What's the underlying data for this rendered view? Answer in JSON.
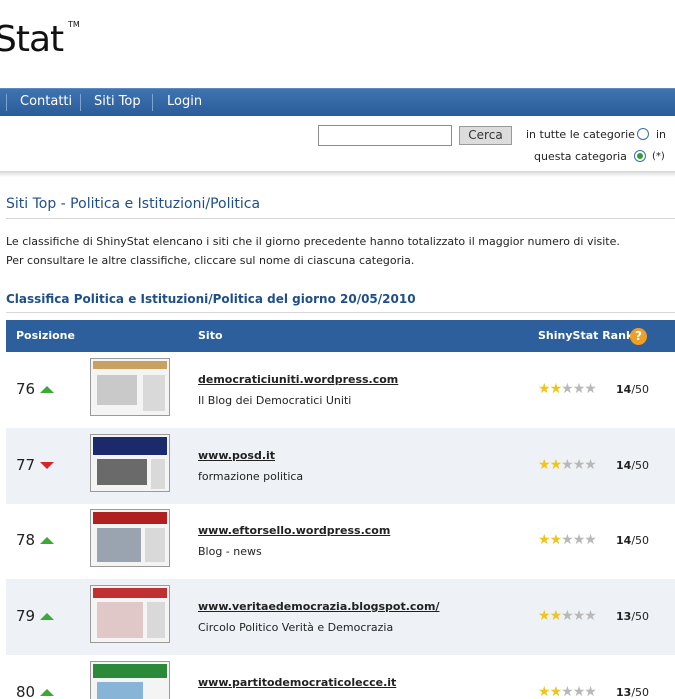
{
  "logo": {
    "text": "Stat",
    "tm": "TM"
  },
  "nav": {
    "items": [
      "Contatti",
      "Siti Top",
      "Login"
    ]
  },
  "search": {
    "value": "",
    "button": "Cerca",
    "option_all": "in tutte le categorie",
    "option_in": "in",
    "option_this": "questa categoria",
    "option_note": "(*)",
    "selected": "questa categoria"
  },
  "page": {
    "title": "Siti Top - Politica e Istituzioni/Politica",
    "intro1": "Le classifiche di ShinyStat elencano i siti che il giorno precedente hanno totalizzato il maggior numero di visite.",
    "intro2": "Per consultare le altre classifiche, cliccare sul nome di ciascuna categoria.",
    "subtitle": "Classifica Politica e Istituzioni/Politica del giorno 20/05/2010"
  },
  "table": {
    "headers": {
      "position": "Posizione",
      "site": "Sito",
      "rank": "ShinyStat Rank",
      "help": "?"
    },
    "rows": [
      {
        "position": "76",
        "trend": "up",
        "url": "democraticiuniti.wordpress.com",
        "desc": "Il Blog dei Democratici Uniti",
        "stars": 1.5,
        "score": "14",
        "max": "/50",
        "thumb_color": "#c8a060"
      },
      {
        "position": "77",
        "trend": "down",
        "url": "www.posd.it",
        "desc": "formazione politica",
        "stars": 1.5,
        "score": "14",
        "max": "/50",
        "thumb_color": "#1a2a6a"
      },
      {
        "position": "78",
        "trend": "up",
        "url": "www.eftorsello.wordpress.com",
        "desc": "Blog - news",
        "stars": 1.5,
        "score": "14",
        "max": "/50",
        "thumb_color": "#b02020"
      },
      {
        "position": "79",
        "trend": "up",
        "url": "www.veritaedemocrazia.blogspot.com/",
        "desc": "Circolo Politico Verità e Democrazia",
        "stars": 1.5,
        "score": "13",
        "max": "/50",
        "thumb_color": "#c03030"
      },
      {
        "position": "80",
        "trend": "up",
        "url": "www.partitodemocraticolecce.it",
        "desc": "",
        "stars": 1.5,
        "score": "13",
        "max": "/50",
        "thumb_color": "#2a8a3a"
      }
    ]
  },
  "colors": {
    "nav": "#2d5f9c",
    "title": "#1f4f8a",
    "up": "#3aa935",
    "down": "#d0282a",
    "star": "#f0c419"
  }
}
